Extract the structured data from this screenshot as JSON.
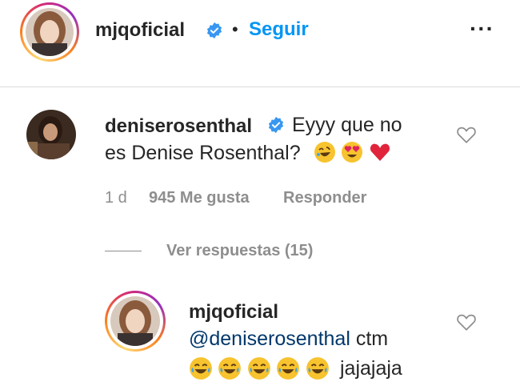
{
  "post_header": {
    "username": "mjqoficial",
    "separator": "•",
    "follow_label": "Seguir",
    "more_icon": "more-options-icon"
  },
  "comment": {
    "username": "deniserosenthal",
    "text_line1": "Eyyy que no",
    "text_line2": "es Denise Rosenthal?",
    "emojis": [
      "rolling-on-floor-laughing-emoji",
      "heart-eyes-emoji",
      "red-heart-emoji"
    ],
    "time": "1 d",
    "likes": "945 Me gusta",
    "reply_label": "Responder",
    "view_replies": "Ver respuestas (15)"
  },
  "reply": {
    "username": "mjqoficial",
    "mention": "@deniserosenthal",
    "text": "ctm",
    "emojis": [
      "tears-of-joy-emoji",
      "tears-of-joy-emoji",
      "tears-of-joy-emoji",
      "tears-of-joy-emoji",
      "tears-of-joy-emoji"
    ],
    "trailing_text": "jajajaja"
  },
  "colors": {
    "link_blue": "#0095f6",
    "verified_blue": "#3897f0",
    "muted": "#8e8e8e",
    "mention": "#00376b"
  }
}
